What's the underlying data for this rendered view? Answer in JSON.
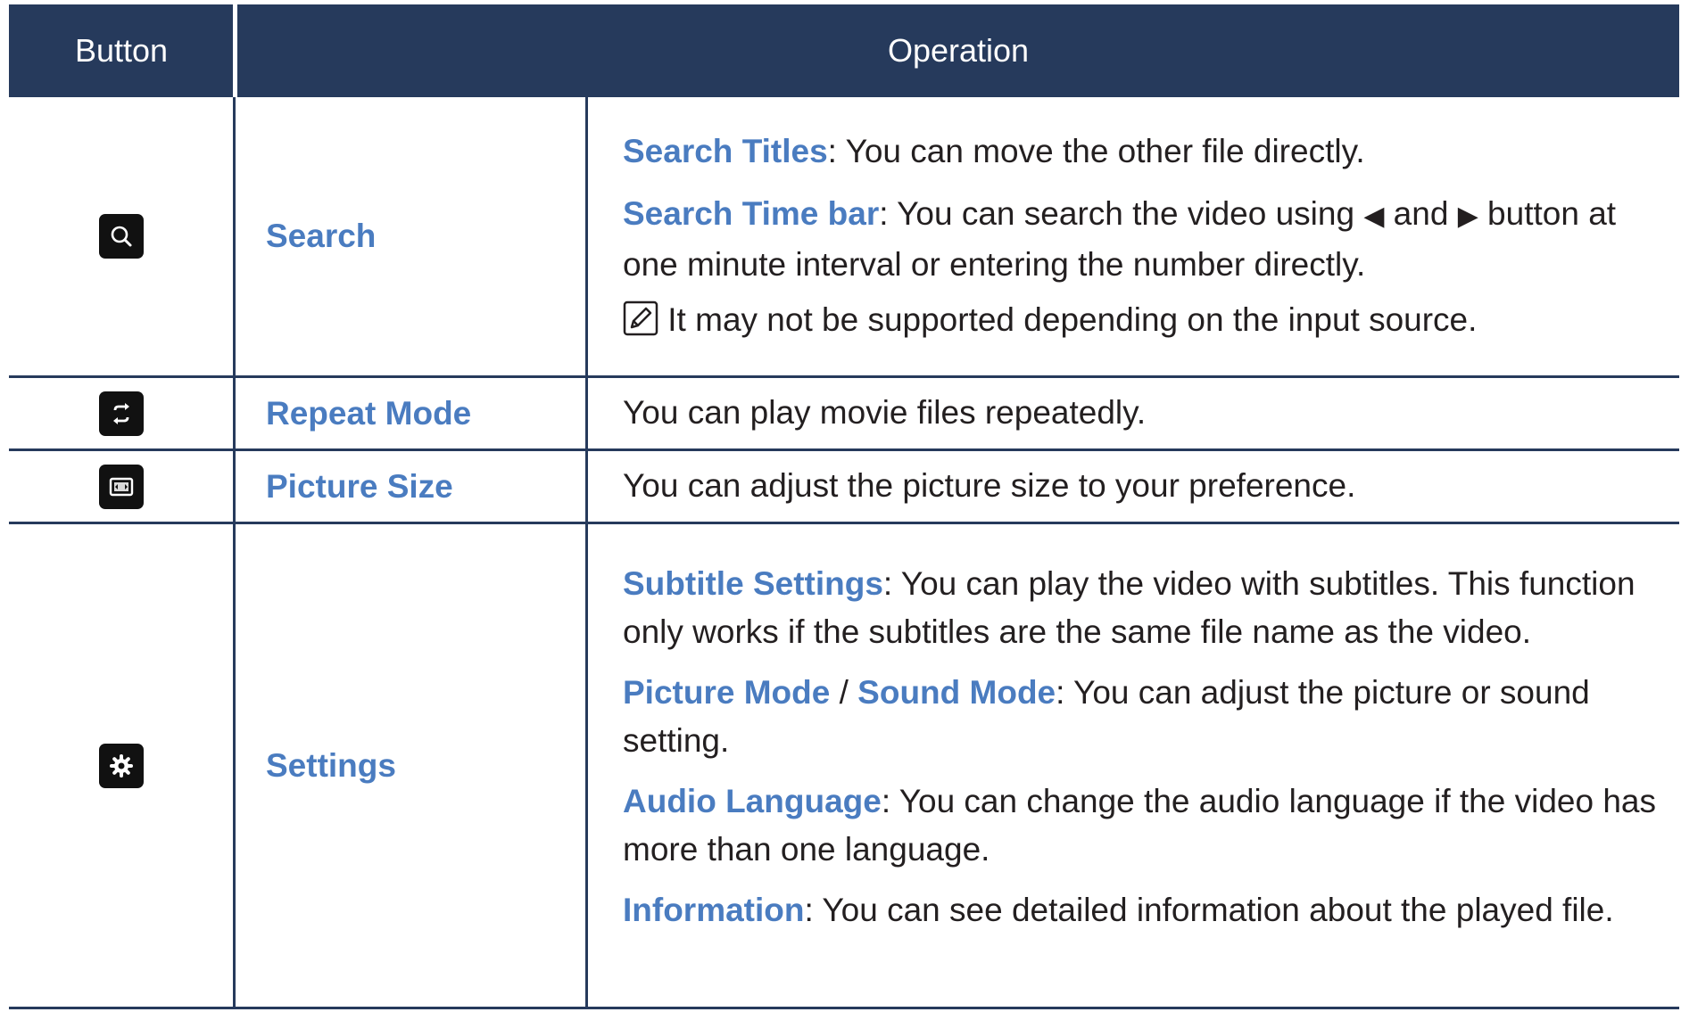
{
  "header": {
    "button_col": "Button",
    "operation_col": "Operation"
  },
  "rows": [
    {
      "icon": "search-icon",
      "name": "Search",
      "items": [
        {
          "keyword": "Search Titles",
          "text": ": You can move the other file directly."
        },
        {
          "keyword": "Search Time bar",
          "text_a": ": You can search the video using ",
          "left_arrow": "◀",
          "text_b": " and ",
          "right_arrow": "▶",
          "text_c": " button at one minute interval or entering the number directly."
        }
      ],
      "note_icon": "note-icon",
      "note": " It may not be supported depending on the input source."
    },
    {
      "icon": "repeat-icon",
      "name": "Repeat Mode",
      "text": "You can play movie files repeatedly."
    },
    {
      "icon": "picture-size-icon",
      "name": "Picture Size",
      "text": "You can adjust the picture size to your preference."
    },
    {
      "icon": "gear-icon",
      "name": "Settings",
      "items": [
        {
          "keyword": "Subtitle Settings",
          "text": ": You can play the video with subtitles. This function only works if the subtitles are the same file name as the video."
        },
        {
          "keyword": "Picture Mode",
          "sep": " / ",
          "keyword2": "Sound Mode",
          "text": ": You can adjust the picture or sound setting."
        },
        {
          "keyword": "Audio Language",
          "text": ": You can change the audio language if the video has more than one language."
        },
        {
          "keyword": "Information",
          "text": ": You can see detailed information about the played file."
        }
      ]
    }
  ],
  "colors": {
    "header_bg": "#263a5c",
    "keyword": "#4a7cc0",
    "text": "#231f20",
    "icon_bg": "#111111"
  }
}
